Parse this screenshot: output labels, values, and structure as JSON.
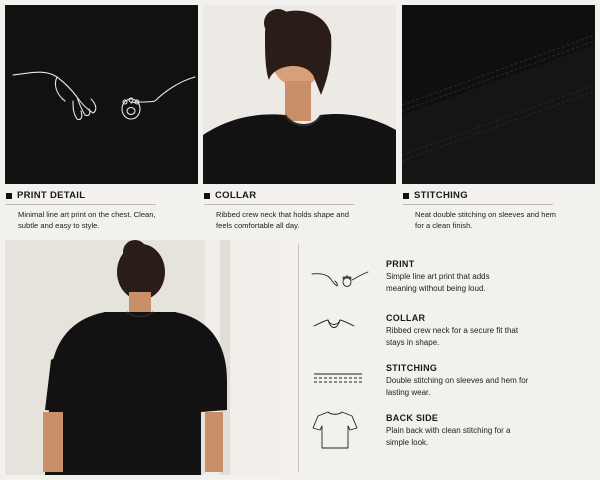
{
  "captions": [
    {
      "title": "PRINT DETAIL",
      "desc": "Minimal line art print on the chest. Clean, subtle and easy to style."
    },
    {
      "title": "COLLAR",
      "desc": "Ribbed crew neck that holds shape and feels comfortable all day."
    },
    {
      "title": "STITCHING",
      "desc": "Neat double stitching on sleeves and hem for a clean finish."
    }
  ],
  "features": [
    {
      "title": "PRINT",
      "desc": "Simple line art print that adds meaning without being loud.",
      "icon": "hand-paw-icon"
    },
    {
      "title": "COLLAR",
      "desc": "Ribbed crew neck for a secure fit that stays in shape.",
      "icon": "collar-icon"
    },
    {
      "title": "STITCHING",
      "desc": "Double stitching on sleeves and hem for lasting wear.",
      "icon": "stitch-icon"
    },
    {
      "title": "BACK SIDE",
      "desc": "Plain back with clean stitching for a simple look.",
      "icon": "tshirt-back-icon"
    }
  ],
  "colors": {
    "background": "#f3f1ee",
    "fabric": "#121212",
    "accent_line": "#bdb8b2"
  }
}
